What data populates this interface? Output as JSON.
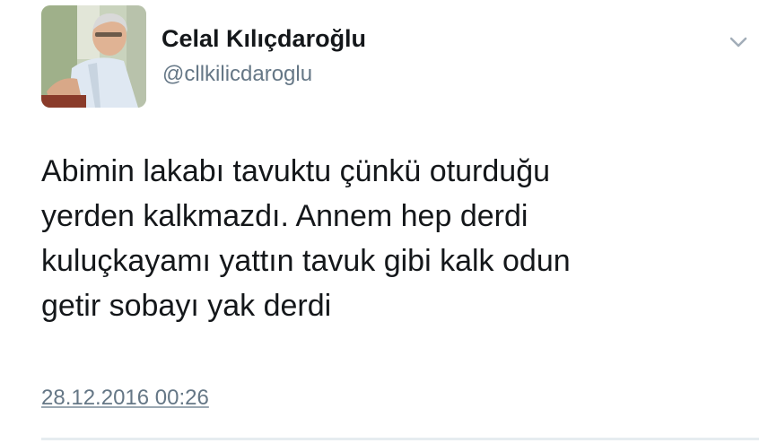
{
  "author": {
    "display_name": "Celal Kılıçdaroğlu",
    "handle": "@cllkilicdaroglu"
  },
  "tweet": {
    "text": "Abimin lakabı tavuktu çünkü oturduğu\nyerden kalkmazdı. Annem hep derdi\nkuluçkayamı yattın tavuk gibi kalk odun\ngetir sobayı yak derdi",
    "timestamp": "28.12.2016 00:26"
  },
  "icons": {
    "menu": "chevron-down-icon",
    "avatar": "profile-photo"
  },
  "colors": {
    "text_primary": "#14171a",
    "text_secondary": "#657786",
    "divider": "#e6ecf0"
  }
}
